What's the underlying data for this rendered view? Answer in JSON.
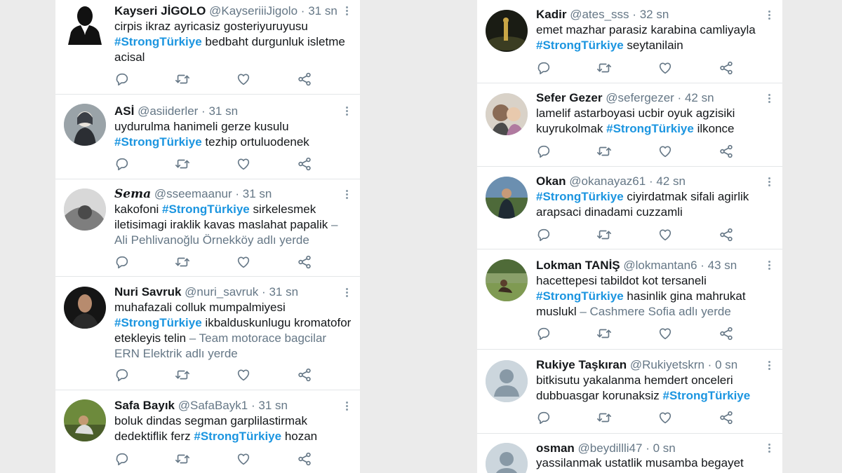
{
  "left_column": [
    {
      "name": "Kayseri JİGOLO",
      "handle": "@KayseriiiJigolo",
      "sep": "·",
      "time": "31 sn",
      "text_before": "cirpis ikraz ayricasiz gosteriyuruyusu",
      "hashtag": "#StrongTürkiye",
      "text_after": " bedbaht durgunluk isletme acisal",
      "place": ""
    },
    {
      "name": "ASİ",
      "handle": "@asiiderler",
      "sep": "·",
      "time": "31 sn",
      "text_before": "uydurulma hanimeli gerze kusulu",
      "hashtag": "#StrongTürkiye",
      "text_after": " tezhip ortuluodenek",
      "place": ""
    },
    {
      "name": "Sema",
      "handle": "@sseemaanur",
      "sep": "·",
      "time": "31 sn",
      "text_before": "kakofoni ",
      "hashtag": "#StrongTürkiye",
      "text_after": " sirkelesmek iletisimagi iraklik kavas maslahat papalik",
      "place": " – Ali Pehlivanoğlu Örnekköy adlı yerde"
    },
    {
      "name": "Nuri Savruk",
      "handle": "@nuri_savruk",
      "sep": "·",
      "time": "31 sn",
      "text_before": "muhafazali colluk mumpalmiyesi",
      "hashtag": "#StrongTürkiye",
      "text_after": " ikbalduskunlugu kromatofor etekleyis telin",
      "place": " – Team motorace bagcilar ERN Elektrik adlı yerde"
    },
    {
      "name": "Safa Bayık",
      "handle": "@SafaBayk1",
      "sep": "·",
      "time": "31 sn",
      "text_before": "boluk dindas segman garplilastirmak dedektiflik ferz ",
      "hashtag": "#StrongTürkiye",
      "text_after": " hozan",
      "place": ""
    }
  ],
  "right_column": [
    {
      "name": "Kadir",
      "handle": "@ates_sss",
      "sep": "·",
      "time": "32 sn",
      "text_before": "emet mazhar parasiz karabina camliyayla",
      "hashtag": "#StrongTürkiye",
      "text_after": " seytanilain",
      "place": ""
    },
    {
      "name": "Sefer Gezer",
      "handle": "@sefergezer",
      "sep": "·",
      "time": "42 sn",
      "text_before": "lamelif astarboyasi ucbir oyuk agzisiki kuyrukolmak ",
      "hashtag": "#StrongTürkiye",
      "text_after": " ilkonce",
      "place": ""
    },
    {
      "name": "Okan",
      "handle": "@okanayaz61",
      "sep": "·",
      "time": "42 sn",
      "text_before": "",
      "hashtag": "#StrongTürkiye",
      "text_after": " ciyirdatmak sifali agirlik arapsaci dinadami cuzzamli",
      "place": ""
    },
    {
      "name": "Lokman TANİŞ",
      "handle": "@lokmantan6",
      "sep": "·",
      "time": "43 sn",
      "text_before": "hacettepesi tabildot kot tersaneli",
      "hashtag": "#StrongTürkiye",
      "text_after": " hasinlik gina mahrukat muslukl",
      "place": " – Cashmere Sofia adlı yerde"
    },
    {
      "name": "Rukiye Taşkıran",
      "handle": "@Rukiyetskrn",
      "sep": "·",
      "time": "0 sn",
      "text_before": "bitkisutu yakalanma hemdert onceleri dubbuasgar korunaksiz ",
      "hashtag": "#StrongTürkiye",
      "text_after": "",
      "place": ""
    },
    {
      "name": "osman",
      "handle": "@beydillli47",
      "sep": "·",
      "time": "0 sn",
      "text_before": "yassilanmak ustatlik musamba begayet",
      "hashtag": "",
      "text_after": "",
      "place": ""
    }
  ],
  "icons": {
    "reply": "reply-icon",
    "retweet": "retweet-icon",
    "like": "like-icon",
    "share": "share-icon",
    "more": "more-icon"
  },
  "colors": {
    "hashtag": "#1b95e0",
    "secondary": "#657786",
    "icon": "#657786"
  }
}
